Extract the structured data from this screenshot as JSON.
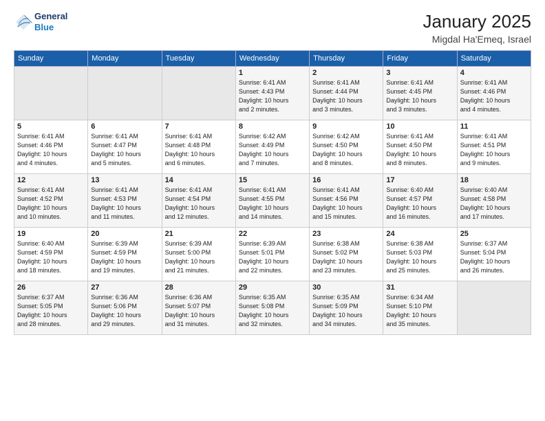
{
  "logo": {
    "text_general": "General",
    "text_blue": "Blue"
  },
  "header": {
    "title": "January 2025",
    "subtitle": "Migdal Ha'Emeq, Israel"
  },
  "days_of_week": [
    "Sunday",
    "Monday",
    "Tuesday",
    "Wednesday",
    "Thursday",
    "Friday",
    "Saturday"
  ],
  "weeks": [
    [
      {
        "day": "",
        "info": ""
      },
      {
        "day": "",
        "info": ""
      },
      {
        "day": "",
        "info": ""
      },
      {
        "day": "1",
        "info": "Sunrise: 6:41 AM\nSunset: 4:43 PM\nDaylight: 10 hours\nand 2 minutes."
      },
      {
        "day": "2",
        "info": "Sunrise: 6:41 AM\nSunset: 4:44 PM\nDaylight: 10 hours\nand 3 minutes."
      },
      {
        "day": "3",
        "info": "Sunrise: 6:41 AM\nSunset: 4:45 PM\nDaylight: 10 hours\nand 3 minutes."
      },
      {
        "day": "4",
        "info": "Sunrise: 6:41 AM\nSunset: 4:46 PM\nDaylight: 10 hours\nand 4 minutes."
      }
    ],
    [
      {
        "day": "5",
        "info": "Sunrise: 6:41 AM\nSunset: 4:46 PM\nDaylight: 10 hours\nand 4 minutes."
      },
      {
        "day": "6",
        "info": "Sunrise: 6:41 AM\nSunset: 4:47 PM\nDaylight: 10 hours\nand 5 minutes."
      },
      {
        "day": "7",
        "info": "Sunrise: 6:41 AM\nSunset: 4:48 PM\nDaylight: 10 hours\nand 6 minutes."
      },
      {
        "day": "8",
        "info": "Sunrise: 6:42 AM\nSunset: 4:49 PM\nDaylight: 10 hours\nand 7 minutes."
      },
      {
        "day": "9",
        "info": "Sunrise: 6:42 AM\nSunset: 4:50 PM\nDaylight: 10 hours\nand 8 minutes."
      },
      {
        "day": "10",
        "info": "Sunrise: 6:41 AM\nSunset: 4:50 PM\nDaylight: 10 hours\nand 8 minutes."
      },
      {
        "day": "11",
        "info": "Sunrise: 6:41 AM\nSunset: 4:51 PM\nDaylight: 10 hours\nand 9 minutes."
      }
    ],
    [
      {
        "day": "12",
        "info": "Sunrise: 6:41 AM\nSunset: 4:52 PM\nDaylight: 10 hours\nand 10 minutes."
      },
      {
        "day": "13",
        "info": "Sunrise: 6:41 AM\nSunset: 4:53 PM\nDaylight: 10 hours\nand 11 minutes."
      },
      {
        "day": "14",
        "info": "Sunrise: 6:41 AM\nSunset: 4:54 PM\nDaylight: 10 hours\nand 12 minutes."
      },
      {
        "day": "15",
        "info": "Sunrise: 6:41 AM\nSunset: 4:55 PM\nDaylight: 10 hours\nand 14 minutes."
      },
      {
        "day": "16",
        "info": "Sunrise: 6:41 AM\nSunset: 4:56 PM\nDaylight: 10 hours\nand 15 minutes."
      },
      {
        "day": "17",
        "info": "Sunrise: 6:40 AM\nSunset: 4:57 PM\nDaylight: 10 hours\nand 16 minutes."
      },
      {
        "day": "18",
        "info": "Sunrise: 6:40 AM\nSunset: 4:58 PM\nDaylight: 10 hours\nand 17 minutes."
      }
    ],
    [
      {
        "day": "19",
        "info": "Sunrise: 6:40 AM\nSunset: 4:59 PM\nDaylight: 10 hours\nand 18 minutes."
      },
      {
        "day": "20",
        "info": "Sunrise: 6:39 AM\nSunset: 4:59 PM\nDaylight: 10 hours\nand 19 minutes."
      },
      {
        "day": "21",
        "info": "Sunrise: 6:39 AM\nSunset: 5:00 PM\nDaylight: 10 hours\nand 21 minutes."
      },
      {
        "day": "22",
        "info": "Sunrise: 6:39 AM\nSunset: 5:01 PM\nDaylight: 10 hours\nand 22 minutes."
      },
      {
        "day": "23",
        "info": "Sunrise: 6:38 AM\nSunset: 5:02 PM\nDaylight: 10 hours\nand 23 minutes."
      },
      {
        "day": "24",
        "info": "Sunrise: 6:38 AM\nSunset: 5:03 PM\nDaylight: 10 hours\nand 25 minutes."
      },
      {
        "day": "25",
        "info": "Sunrise: 6:37 AM\nSunset: 5:04 PM\nDaylight: 10 hours\nand 26 minutes."
      }
    ],
    [
      {
        "day": "26",
        "info": "Sunrise: 6:37 AM\nSunset: 5:05 PM\nDaylight: 10 hours\nand 28 minutes."
      },
      {
        "day": "27",
        "info": "Sunrise: 6:36 AM\nSunset: 5:06 PM\nDaylight: 10 hours\nand 29 minutes."
      },
      {
        "day": "28",
        "info": "Sunrise: 6:36 AM\nSunset: 5:07 PM\nDaylight: 10 hours\nand 31 minutes."
      },
      {
        "day": "29",
        "info": "Sunrise: 6:35 AM\nSunset: 5:08 PM\nDaylight: 10 hours\nand 32 minutes."
      },
      {
        "day": "30",
        "info": "Sunrise: 6:35 AM\nSunset: 5:09 PM\nDaylight: 10 hours\nand 34 minutes."
      },
      {
        "day": "31",
        "info": "Sunrise: 6:34 AM\nSunset: 5:10 PM\nDaylight: 10 hours\nand 35 minutes."
      },
      {
        "day": "",
        "info": ""
      }
    ]
  ]
}
